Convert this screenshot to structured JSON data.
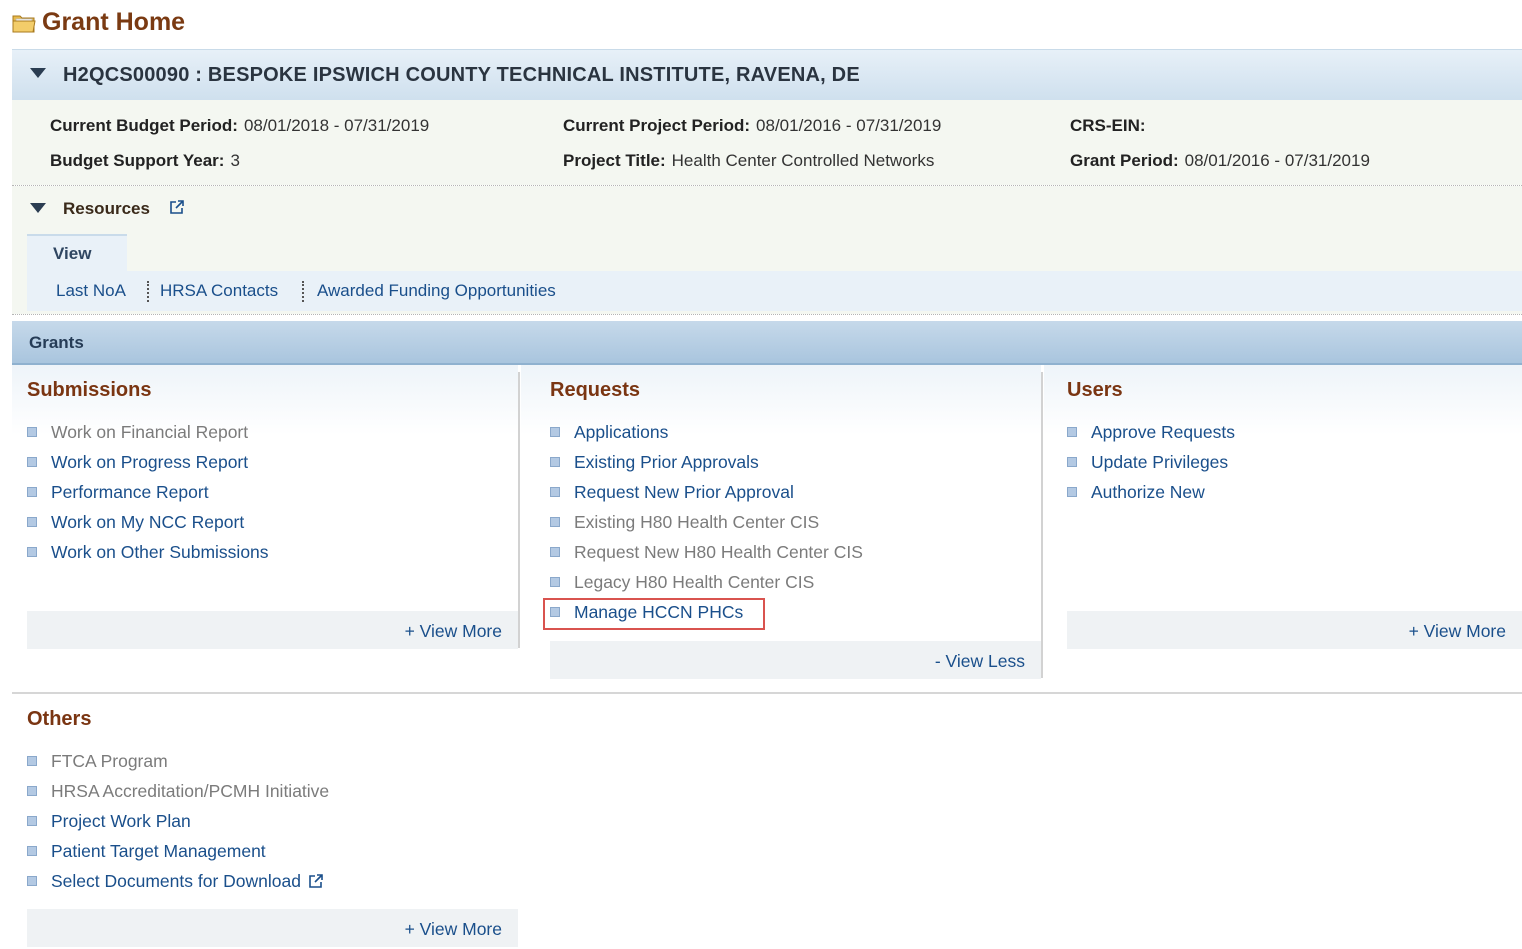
{
  "page": {
    "title": "Grant Home"
  },
  "grant": {
    "header": "H2QCS00090 : BESPOKE IPSWICH COUNTY TECHNICAL INSTITUTE, RAVENA, DE",
    "current_budget_period_label": "Current Budget Period:",
    "current_budget_period": "08/01/2018 - 07/31/2019",
    "budget_support_year_label": "Budget Support Year:",
    "budget_support_year": "3",
    "current_project_period_label": "Current Project Period:",
    "current_project_period": "08/01/2016 - 07/31/2019",
    "project_title_label": "Project Title:",
    "project_title": "Health Center Controlled Networks",
    "crs_ein_label": "CRS-EIN:",
    "crs_ein": "",
    "grant_period_label": "Grant Period:",
    "grant_period": "08/01/2016 - 07/31/2019"
  },
  "resources": {
    "label": "Resources",
    "view_tab": "View",
    "links": [
      "Last NoA",
      "HRSA Contacts",
      "Awarded Funding Opportunities"
    ]
  },
  "grants_bar": {
    "label": "Grants"
  },
  "submissions": {
    "title": "Submissions",
    "items": [
      {
        "label": "Work on Financial Report",
        "enabled": false
      },
      {
        "label": "Work on Progress Report",
        "enabled": true
      },
      {
        "label": "Performance Report",
        "enabled": true
      },
      {
        "label": "Work on My NCC Report",
        "enabled": true
      },
      {
        "label": "Work on Other Submissions",
        "enabled": true
      }
    ],
    "more": "+ View More"
  },
  "requests": {
    "title": "Requests",
    "items": [
      {
        "label": "Applications",
        "enabled": true
      },
      {
        "label": "Existing Prior Approvals",
        "enabled": true
      },
      {
        "label": "Request New Prior Approval",
        "enabled": true
      },
      {
        "label": "Existing H80 Health Center CIS",
        "enabled": false
      },
      {
        "label": "Request New H80 Health Center CIS",
        "enabled": false
      },
      {
        "label": "Legacy H80 Health Center CIS",
        "enabled": false
      },
      {
        "label": "Manage HCCN PHCs",
        "enabled": true,
        "highlighted": true
      }
    ],
    "less": "- View Less"
  },
  "users": {
    "title": "Users",
    "items": [
      {
        "label": "Approve Requests",
        "enabled": true
      },
      {
        "label": "Update Privileges",
        "enabled": true
      },
      {
        "label": "Authorize New",
        "enabled": true
      }
    ],
    "more": "+ View More"
  },
  "others": {
    "title": "Others",
    "items": [
      {
        "label": "FTCA Program",
        "enabled": false
      },
      {
        "label": "HRSA Accreditation/PCMH Initiative",
        "enabled": false
      },
      {
        "label": "Project Work Plan",
        "enabled": true
      },
      {
        "label": "Patient Target Management",
        "enabled": true
      },
      {
        "label": "Select Documents for Download",
        "enabled": true,
        "external": true
      }
    ],
    "more": "+ View More"
  },
  "colors": {
    "title_brown": "#7a3512",
    "link_blue": "#1a4f8b",
    "disabled_gray": "#7b7b7b",
    "highlight_red": "#d9534f"
  }
}
